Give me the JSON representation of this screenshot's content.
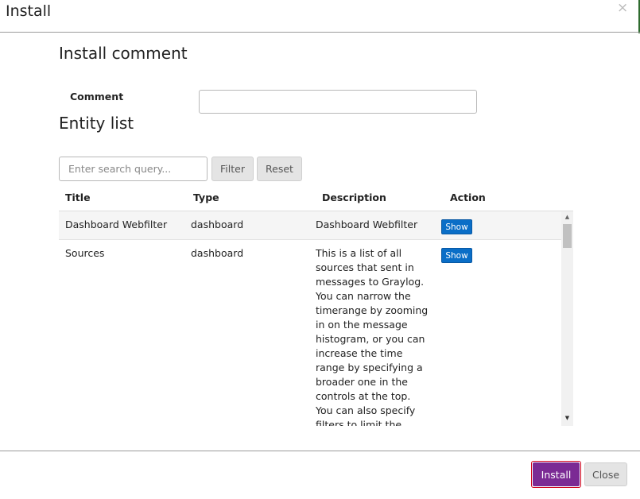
{
  "modal": {
    "title": "Install",
    "close_glyph": "×"
  },
  "comment_section": {
    "title": "Install comment",
    "label": "Comment",
    "value": ""
  },
  "entity_section": {
    "title": "Entity list",
    "search_placeholder": "Enter search query...",
    "filter_label": "Filter",
    "reset_label": "Reset"
  },
  "table": {
    "columns": [
      "Title",
      "Type",
      "Description",
      "Action"
    ],
    "rows": [
      {
        "title": "Dashboard Webfilter",
        "type": "dashboard",
        "description": "Dashboard Webfilter",
        "action": "Show"
      },
      {
        "title": "Sources",
        "type": "dashboard",
        "description": "This is a list of all sources that sent in messages to Graylog. You can narrow the timerange by zooming in on the message histogram, or you can increase the time range by specifying a broader one in the controls at the top. You can also specify filters to limit the results you are",
        "action": "Show"
      }
    ]
  },
  "footer": {
    "install_label": "Install",
    "close_label": "Close"
  },
  "icons": {
    "scroll_up": "▲",
    "scroll_down": "▼"
  },
  "colors": {
    "install_button": "#7b2a94",
    "show_button": "#0a6ec7",
    "focus_outline": "#d0021b"
  }
}
